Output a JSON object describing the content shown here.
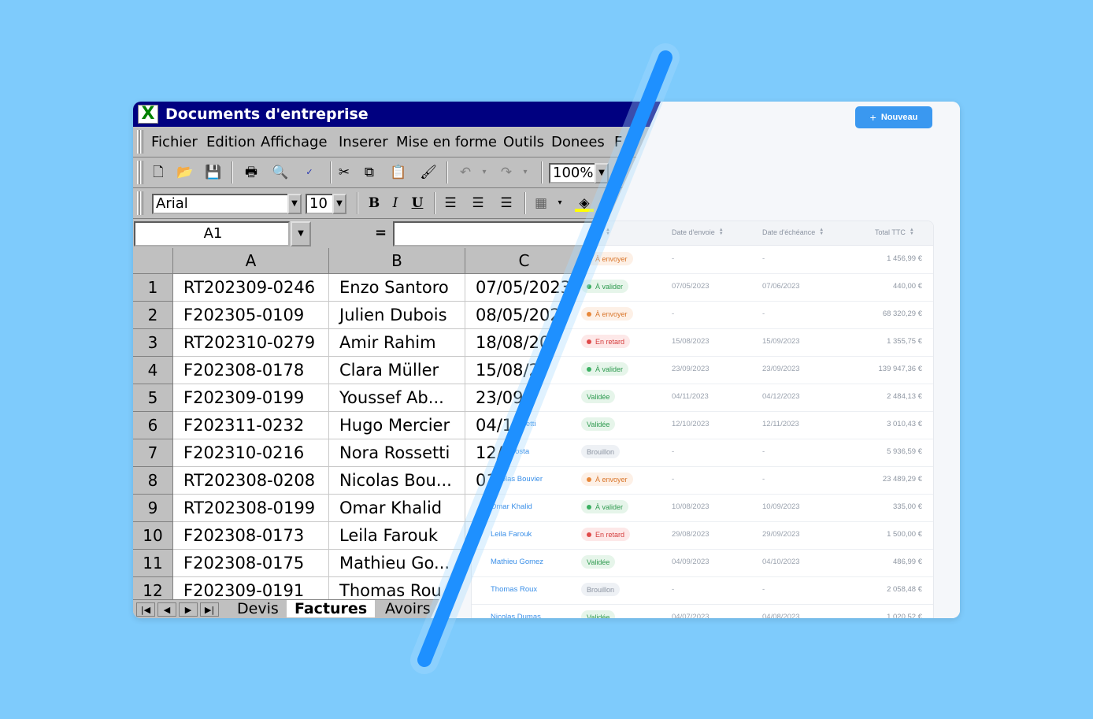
{
  "legacy": {
    "window_title": "Documents d'entreprise",
    "app_icon": "X",
    "menu": [
      "Fichier",
      "Edition",
      "Affichage",
      "Inserer",
      "Mise en forme",
      "Outils",
      "Donees",
      "F"
    ],
    "zoom": "100%",
    "font_name": "Arial",
    "font_size": "10",
    "cell_ref": "A1",
    "equals": "=",
    "format_buttons": {
      "bold": "B",
      "italic": "I",
      "underline": "U"
    },
    "columns": [
      "A",
      "B",
      "C"
    ],
    "rows": [
      {
        "n": "1",
        "a": "RT202309-0246",
        "b": "Enzo Santoro",
        "c": "07/05/2023"
      },
      {
        "n": "2",
        "a": "F202305-0109",
        "b": "Julien Dubois",
        "c": "08/05/2023"
      },
      {
        "n": "3",
        "a": "RT202310-0279",
        "b": "Amir Rahim",
        "c": "18/08/2023"
      },
      {
        "n": "4",
        "a": "F202308-0178",
        "b": "Clara Müller",
        "c": "15/08/2023"
      },
      {
        "n": "5",
        "a": "F202309-0199",
        "b": "Youssef Ab...",
        "c": "23/09/2023"
      },
      {
        "n": "6",
        "a": "F202311-0232",
        "b": "Hugo Mercier",
        "c": "04/11/2023"
      },
      {
        "n": "7",
        "a": "F202310-0216",
        "b": "Nora Rossetti",
        "c": "12/10/2023"
      },
      {
        "n": "8",
        "a": "RT202308-0208",
        "b": "Nicolas Bou...",
        "c": "01/08/2023"
      },
      {
        "n": "9",
        "a": "RT202308-0199",
        "b": "Omar Khalid",
        "c": ""
      },
      {
        "n": "10",
        "a": "F202308-0173",
        "b": "Leila Farouk",
        "c": ""
      },
      {
        "n": "11",
        "a": "F202308-0175",
        "b": "Mathieu Go...",
        "c": ""
      },
      {
        "n": "12",
        "a": "F202309-0191",
        "b": "Thomas Rou",
        "c": ""
      }
    ],
    "sheet_tabs": [
      "Devis",
      "Factures",
      "Avoirs"
    ],
    "active_tab": "Factures"
  },
  "modern": {
    "new_button": "Nouveau",
    "headers": {
      "send_date": "Date d'envoie",
      "due_date": "Date d'échéance",
      "total": "Total TTC"
    },
    "rows": [
      {
        "client": "",
        "status": "À envoyer",
        "kind": "orange",
        "send": "-",
        "due": "-",
        "total": "1 456,99 €"
      },
      {
        "client": "",
        "status": "À valider",
        "kind": "green",
        "send": "07/05/2023",
        "due": "07/06/2023",
        "total": "440,00 €"
      },
      {
        "client": "",
        "status": "À envoyer",
        "kind": "orange",
        "send": "-",
        "due": "-",
        "total": "68 320,29 €"
      },
      {
        "client": "",
        "status": "En retard",
        "kind": "red",
        "send": "15/08/2023",
        "due": "15/09/2023",
        "total": "1 355,75 €"
      },
      {
        "client": "",
        "status": "À valider",
        "kind": "green",
        "send": "23/09/2023",
        "due": "23/09/2023",
        "total": "139 947,36 €"
      },
      {
        "client": "",
        "status": "Validée",
        "kind": "valid",
        "send": "04/11/2023",
        "due": "04/12/2023",
        "total": "2 484,13 €"
      },
      {
        "client": "Nora Rossetti",
        "status": "Validée",
        "kind": "valid",
        "send": "12/10/2023",
        "due": "12/11/2023",
        "total": "3 010,43 €"
      },
      {
        "client": "Sofia Costa",
        "status": "Brouillon",
        "kind": "draft",
        "send": "-",
        "due": "-",
        "total": "5 936,59 €"
      },
      {
        "client": "Nicolas Bouvier",
        "status": "À envoyer",
        "kind": "orange",
        "send": "-",
        "due": "-",
        "total": "23 489,29 €"
      },
      {
        "client": "Omar Khalid",
        "status": "À valider",
        "kind": "green",
        "send": "10/08/2023",
        "due": "10/09/2023",
        "total": "335,00 €"
      },
      {
        "client": "Leila Farouk",
        "status": "En retard",
        "kind": "red",
        "send": "29/08/2023",
        "due": "29/09/2023",
        "total": "1 500,00 €"
      },
      {
        "client": "Mathieu Gomez",
        "status": "Validée",
        "kind": "valid",
        "send": "04/09/2023",
        "due": "04/10/2023",
        "total": "486,99 €"
      },
      {
        "client": "Thomas Roux",
        "status": "Brouillon",
        "kind": "draft",
        "send": "-",
        "due": "-",
        "total": "2 058,48 €"
      },
      {
        "client": "Nicolas Dumas",
        "status": "Validée",
        "kind": "valid",
        "send": "04/07/2023",
        "due": "04/08/2023",
        "total": "1 020,52 €"
      }
    ]
  },
  "colors": {
    "background": "#7ecbfc",
    "accent": "#3a98f0",
    "slash": "#1e90ff",
    "excel_title": "#000080"
  }
}
